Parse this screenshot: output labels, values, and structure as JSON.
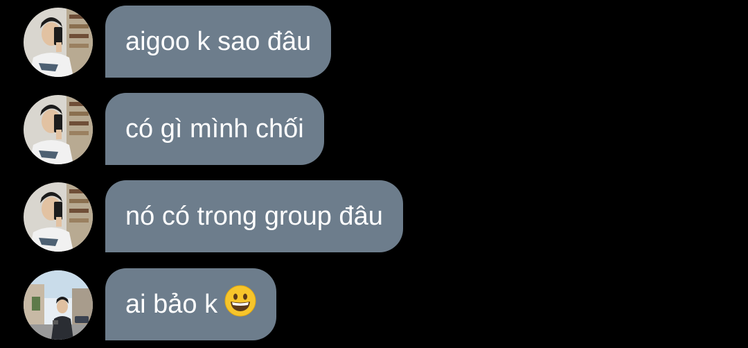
{
  "messages": [
    {
      "text": "aigoo k sao đâu",
      "sender": "contact-a"
    },
    {
      "text": "có gì mình chối",
      "sender": "contact-a"
    },
    {
      "text": "nó có trong group đâu",
      "sender": "contact-a"
    },
    {
      "text": "ai bảo k",
      "sender": "contact-b",
      "emoji": "grinning-face-icon"
    }
  ],
  "colors": {
    "background": "#000000",
    "bubble": "#6d7d8c",
    "text": "#ffffff",
    "emoji_face": "#f7c52b"
  }
}
